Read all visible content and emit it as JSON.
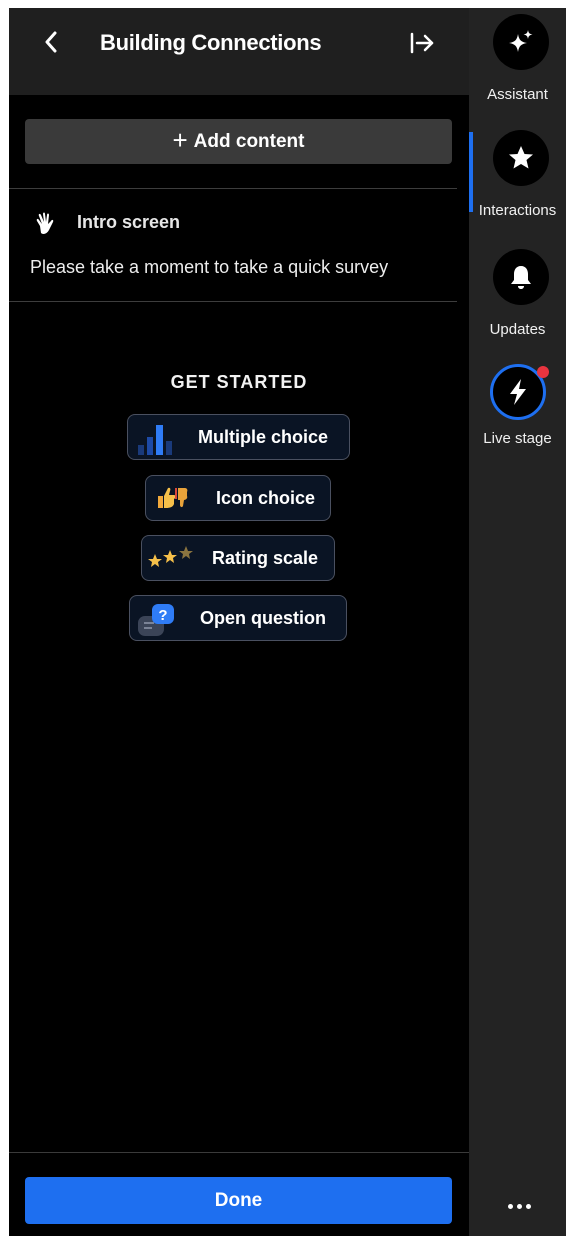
{
  "header": {
    "title": "Building Connections",
    "back_icon": "chevron-left-icon",
    "collapse_icon": "arrow-bar-right-icon"
  },
  "add_content": {
    "icon": "plus-icon",
    "label": "Add content"
  },
  "intro": {
    "icon": "waving-hand-icon",
    "title": "Intro screen",
    "text": "Please take a moment to take a quick survey"
  },
  "get_started": {
    "heading": "GET STARTED",
    "options": [
      {
        "label": "Multiple choice",
        "icon": "bar-chart-icon"
      },
      {
        "label": "Icon choice",
        "icon": "thumbs-icon"
      },
      {
        "label": "Rating scale",
        "icon": "stars-icon"
      },
      {
        "label": "Open question",
        "icon": "question-bubble-icon"
      }
    ]
  },
  "footer": {
    "done_label": "Done"
  },
  "rail": {
    "items": [
      {
        "label": "Assistant",
        "icon": "sparkle-icon"
      },
      {
        "label": "Interactions",
        "icon": "star-icon",
        "active": true
      },
      {
        "label": "Updates",
        "icon": "bell-icon"
      },
      {
        "label": "Live stage",
        "icon": "lightning-icon",
        "notification": true
      }
    ],
    "more_icon": "more-horizontal-icon"
  },
  "colors": {
    "accent": "#1e6ff0",
    "panel_bg": "#000000",
    "header_bg": "#1f1f1f",
    "rail_bg": "#232323",
    "notification": "#e8343f"
  }
}
